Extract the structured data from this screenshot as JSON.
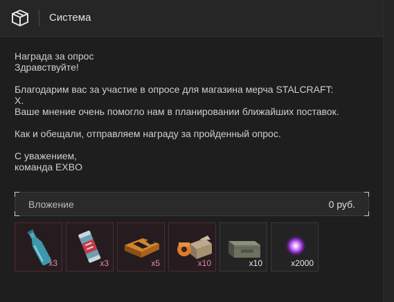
{
  "header": {
    "title": "Система",
    "icon": "box-icon"
  },
  "message": {
    "subject": "Награда за опрос",
    "greeting": "Здравствуйте!",
    "body_line1": "Благодарим вас за участие в опросе для магазина мерча STALCRAFT:",
    "body_line2": "X.",
    "body_line3": "Ваше мнение очень помогло нам в планировании ближайших поставок.",
    "body_line4": "Как и обещали, отправляем награду за пройденный опрос.",
    "signoff1": "С уважением,",
    "signoff2": "команда EXBO"
  },
  "attachment": {
    "label": "Вложение",
    "price": "0 руб."
  },
  "items": [
    {
      "icon": "bottle-icon",
      "qty": "x3",
      "rarity_color": "#e58aa6"
    },
    {
      "icon": "energy-can-icon",
      "qty": "x3",
      "rarity_color": "#e58aa6"
    },
    {
      "icon": "hazard-crate-icon",
      "qty": "x5",
      "rarity_color": "#e58aa6"
    },
    {
      "icon": "cardboard-box-icon",
      "qty": "x10",
      "rarity_color": "#e58aa6"
    },
    {
      "icon": "ammo-box-icon",
      "qty": "x10",
      "rarity_color": "#e8e8e8"
    },
    {
      "icon": "purple-orb-icon",
      "qty": "x2000",
      "rarity_color": "#e8e8e8"
    }
  ]
}
